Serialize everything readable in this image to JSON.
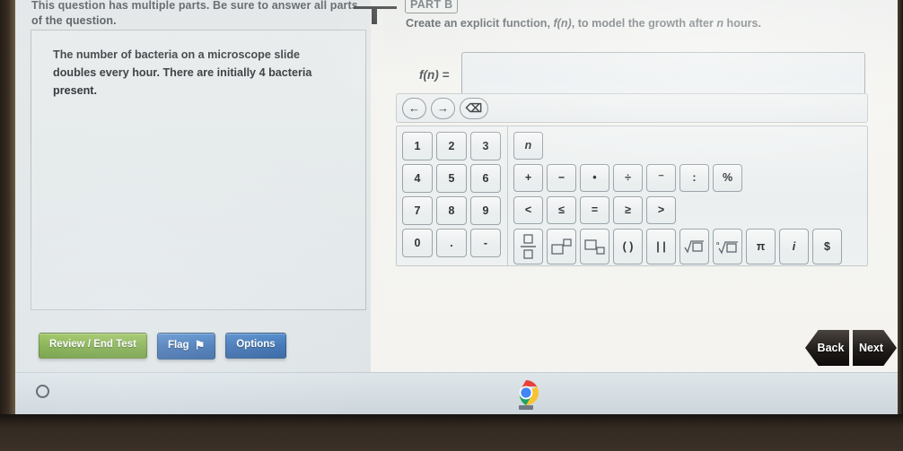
{
  "left_pane": {
    "instruction": "This question has multiple parts. Be sure to answer all parts of the question.",
    "stem": "The number of bacteria on a microscope slide doubles every hour. There are initially 4 bacteria present."
  },
  "right_pane": {
    "part_badge": "PART B",
    "prompt_before": "Create an explicit function, ",
    "prompt_fn": "f(n)",
    "prompt_after": ", to model the growth after ",
    "prompt_var": "n",
    "prompt_end": " hours.",
    "answer_label": "f(n) =",
    "answer_value": "",
    "answer_placeholder": ""
  },
  "keypad": {
    "nav": [
      {
        "name": "cursor-left",
        "glyph": "←"
      },
      {
        "name": "cursor-right",
        "glyph": "→"
      },
      {
        "name": "backspace",
        "glyph": "⌫"
      }
    ],
    "numpad": [
      "1",
      "2",
      "3",
      "4",
      "5",
      "6",
      "7",
      "8",
      "9",
      "0",
      ".",
      "-"
    ],
    "row_variable": [
      "n"
    ],
    "row_operators": [
      "+",
      "−",
      "•",
      "÷",
      "⁻",
      ":",
      "%"
    ],
    "row_relations": [
      "<",
      "≤",
      "=",
      "≥",
      ">"
    ],
    "row_templates": [
      {
        "name": "fraction",
        "label": "fraction"
      },
      {
        "name": "superscript",
        "label": "superscript"
      },
      {
        "name": "subscript",
        "label": "subscript"
      },
      {
        "name": "parentheses",
        "label": "( )"
      },
      {
        "name": "absolute-value",
        "label": "| |"
      },
      {
        "name": "square-root",
        "label": "square-root"
      },
      {
        "name": "nth-root",
        "label": "nth-root"
      },
      {
        "name": "pi",
        "label": "π"
      },
      {
        "name": "imaginary-unit",
        "label": "i"
      },
      {
        "name": "dollar-sign",
        "label": "$"
      }
    ]
  },
  "toolbar": {
    "review_end_test": "Review / End Test",
    "flag": "Flag",
    "flag_glyph": "⚑",
    "options": "Options"
  },
  "navigation": {
    "back": "Back",
    "next": "Next"
  },
  "shelf": {
    "launcher_name": "launcher-circle",
    "chrome_name": "chrome-icon"
  },
  "colors": {
    "green_button": "#6fa22c",
    "blue_button": "#2c65ad",
    "dark_arrow": "#211d1a",
    "panel_bg": "#e7eaea"
  }
}
